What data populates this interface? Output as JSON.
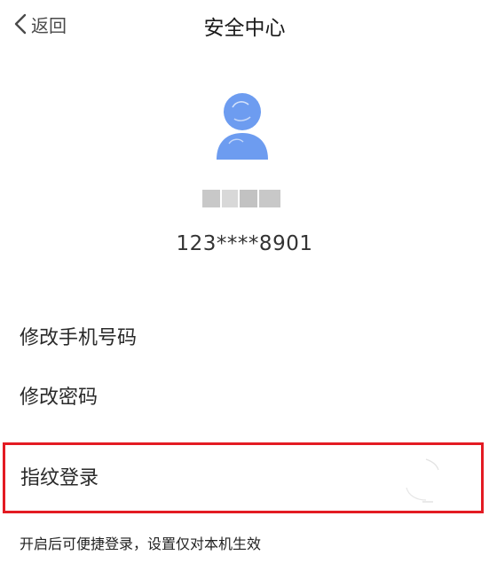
{
  "nav": {
    "back_label": "返回",
    "title": "安全中心"
  },
  "profile": {
    "avatar_icon": "user-avatar-icon",
    "avatar_color": "#6d9cf0",
    "name": "",
    "phone": "123****8901"
  },
  "menu": {
    "items": [
      {
        "label": "修改手机号码"
      },
      {
        "label": "修改密码"
      }
    ]
  },
  "fingerprint": {
    "label": "指纹登录",
    "enabled": false,
    "hint": "开启后可便捷登录，设置仅对本机生效",
    "highlight_color": "#e31b23"
  }
}
